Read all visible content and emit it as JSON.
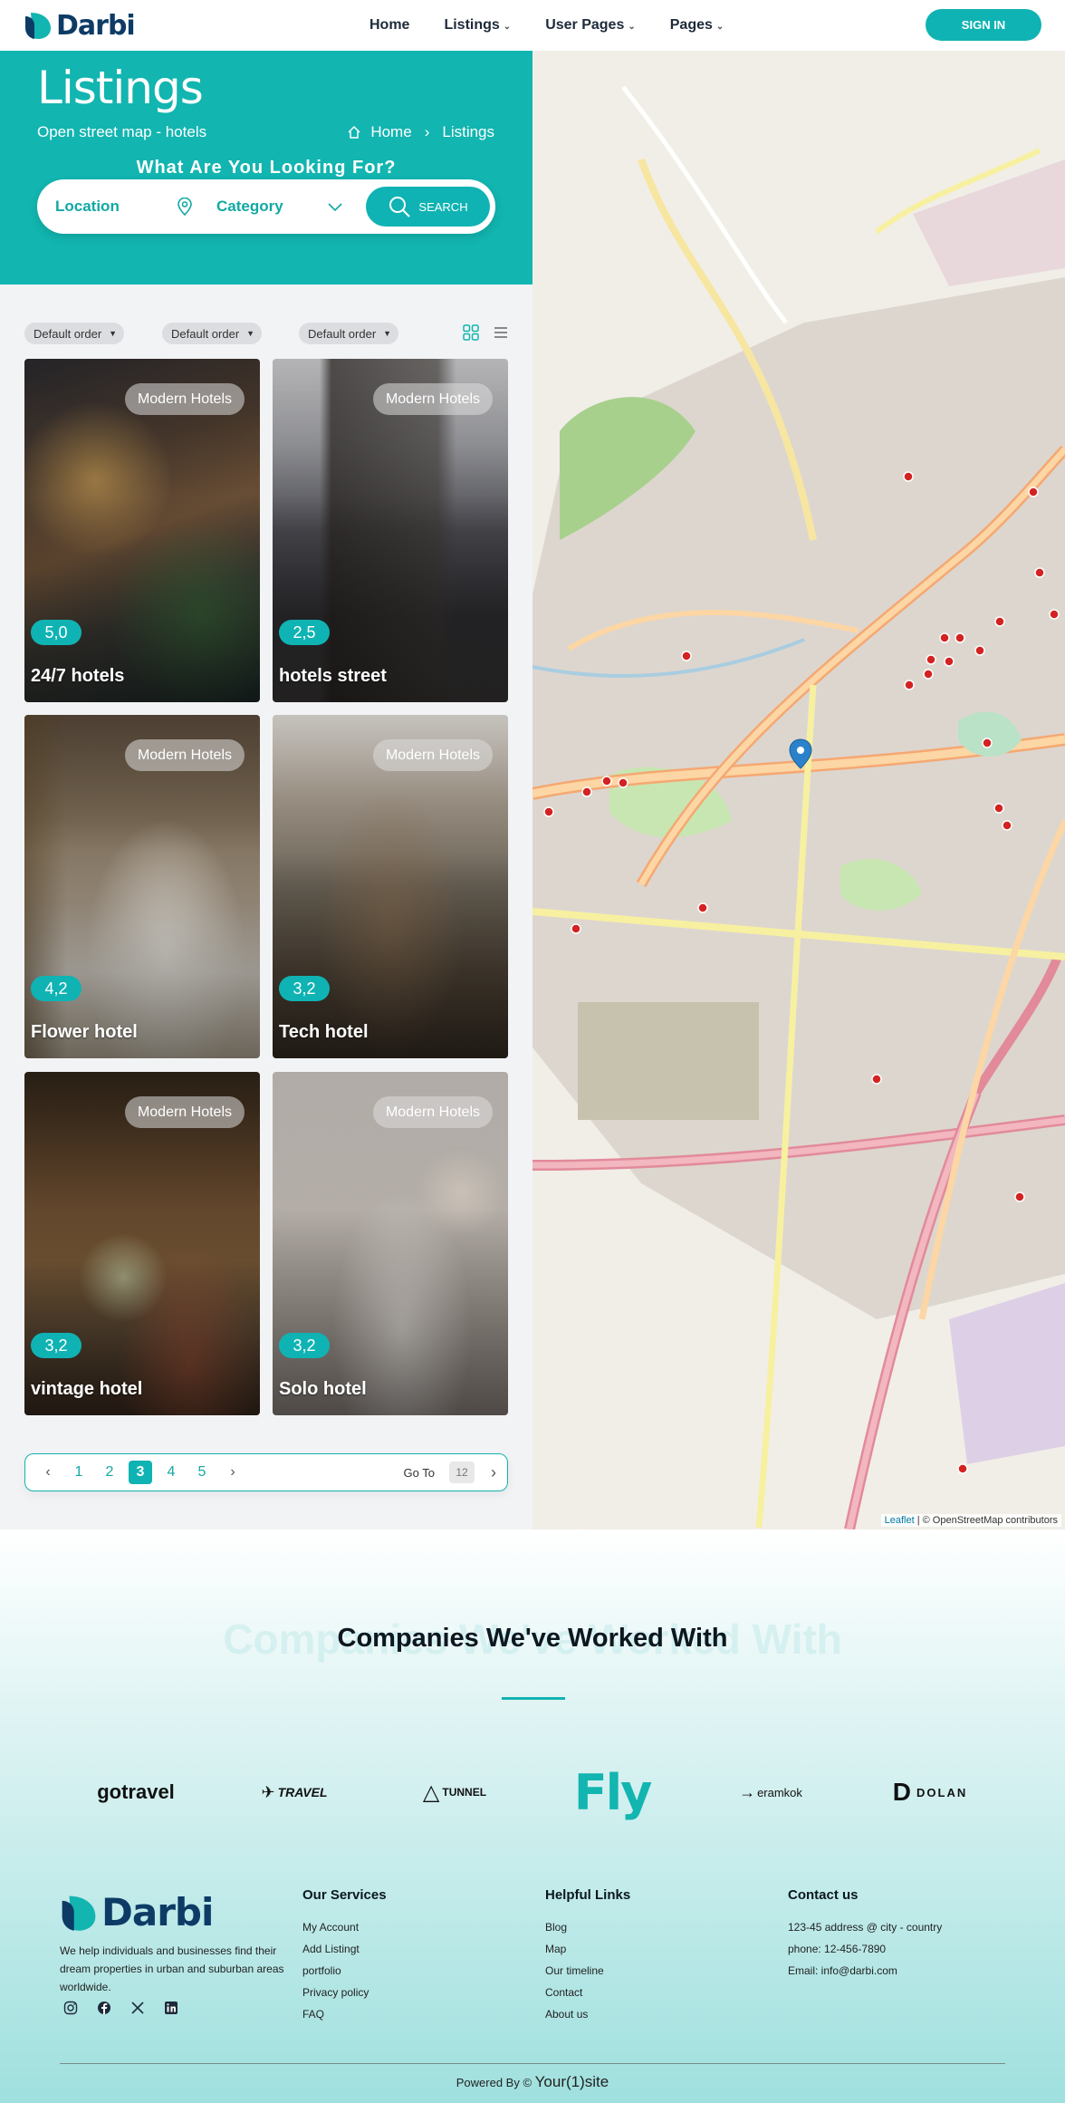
{
  "header": {
    "logo_text": "Darbi",
    "nav": [
      {
        "label": "Home",
        "has_caret": false
      },
      {
        "label": "Listings",
        "has_caret": true
      },
      {
        "label": "User Pages",
        "has_caret": true
      },
      {
        "label": "Pages",
        "has_caret": true
      }
    ],
    "signin_label": "SIGN IN"
  },
  "hero": {
    "title": "Listings",
    "subtitle": "Open street map - hotels",
    "breadcrumb": [
      "Home",
      "Listings"
    ],
    "prompt": "What Are You Looking For?",
    "search": {
      "location_label": "Location",
      "category_label": "Category",
      "button_label": "SEARCH"
    }
  },
  "filters": [
    "Default order",
    "Default order",
    "Default order"
  ],
  "listings": [
    {
      "name": "24/7 hotels",
      "category": "Modern Hotels",
      "rating": "5,0"
    },
    {
      "name": "hotels street",
      "category": "Modern Hotels",
      "rating": "2,5"
    },
    {
      "name": "Flower hotel",
      "category": "Modern Hotels",
      "rating": "4,2"
    },
    {
      "name": "Tech hotel",
      "category": "Modern Hotels",
      "rating": "3,2"
    },
    {
      "name": "vintage hotel",
      "category": "Modern Hotels",
      "rating": "3,2"
    },
    {
      "name": "Solo hotel",
      "category": "Modern Hotels",
      "rating": "3,2"
    }
  ],
  "pagination": {
    "pages": [
      "1",
      "2",
      "3",
      "4",
      "5"
    ],
    "current": "3",
    "goto_label": "Go To",
    "goto_placeholder": "12"
  },
  "map": {
    "attribution_leaflet": "Leaflet",
    "attribution_rest": "| © OpenStreetMap contributors"
  },
  "companies": {
    "title": "Companies We've Worked With",
    "partners": [
      "gotravel",
      "TRAVEL",
      "TUNNEL",
      "Fly",
      "eramkok",
      "DOLAN"
    ]
  },
  "footer": {
    "logo_text": "Darbi",
    "about": "We help individuals and businesses find their dream properties in urban and suburban areas worldwide.",
    "services_title": "Our Services",
    "services": [
      "My Account",
      "Add Listingt",
      "portfolio",
      "Privacy policy",
      "FAQ"
    ],
    "links_title": "Helpful Links",
    "links": [
      "Blog",
      "Map",
      "Our timeline",
      "Contact",
      "About us"
    ],
    "contact_title": "Contact us",
    "contact": [
      "123-45 address @ city - country",
      "phone: 12-456-7890",
      "Email: info@darbi.com"
    ],
    "powered_prefix": "Powered By ©",
    "powered_brand": "Your(1)site"
  },
  "colors": {
    "accent": "#10b3b3",
    "brand_dark": "#0d3b66"
  }
}
